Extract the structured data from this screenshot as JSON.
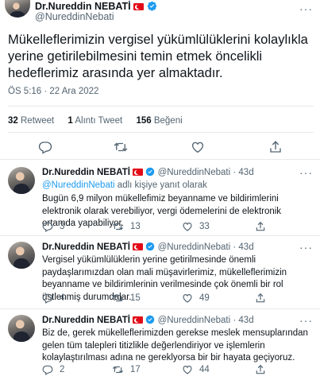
{
  "main": {
    "name": "Dr.Nureddin NEBATİ",
    "handle": "@NureddinNebati",
    "text": "Mükelleflerimizin vergisel yükümlülüklerini kolaylıkla yerine getirilebilmesini temin etmek öncelikli hedeflerimiz arasında yer almaktadır.",
    "timestamp": "ÖS 5:16 · 22 Ara 2022",
    "stats": {
      "retweets": "32",
      "retweets_label": "Retweet",
      "quotes": "1",
      "quotes_label": "Alıntı Tweet",
      "likes": "156",
      "likes_label": "Beğeni"
    }
  },
  "replies": [
    {
      "name": "Dr.Nureddin NEBATİ",
      "handle": "@NureddinNebati",
      "time": "· 43d",
      "replying_handle": "@NureddinNebati",
      "replying_suffix": "adlı kişiye yanıt olarak",
      "text": "Bugün 6,9 milyon mükellefimiz beyanname ve bildirimlerini elektronik olarak verebiliyor, vergi ödemelerini de elektronik ortamda yapabiliyor.",
      "replies": "3",
      "retweets": "13",
      "likes": "33"
    },
    {
      "name": "Dr.Nureddin NEBATİ",
      "handle": "@NureddinNebati",
      "time": "· 43d",
      "text": "Vergisel yükümlülüklerin yerine getirilmesinde önemli paydaşlarımızdan olan mali müşavirlerimiz, mükelleflerimizin beyanname ve bildirimlerinin verilmesinde çok önemli bir rol üstlenmiş durumdalar.",
      "replies": "4",
      "retweets": "15",
      "likes": "49"
    },
    {
      "name": "Dr.Nureddin NEBATİ",
      "handle": "@NureddinNebati",
      "time": "· 43d",
      "text": "Biz de, gerek mükelleflerimizden gerekse meslek mensuplarından gelen tüm talepleri titizlikle değerlendiriyor ve işlemlerin kolaylaştırılması adına ne gereklyorsa bir bir hayata geçiyoruz.",
      "replies": "2",
      "retweets": "17",
      "likes": "44"
    }
  ],
  "colors": {
    "accent": "#1d9bf0",
    "muted": "#536471",
    "flag": "#e30a17"
  },
  "icons": [
    "verified-badge-icon",
    "turkey-flag-icon",
    "more-icon",
    "reply-icon",
    "retweet-icon",
    "like-icon",
    "share-icon"
  ]
}
